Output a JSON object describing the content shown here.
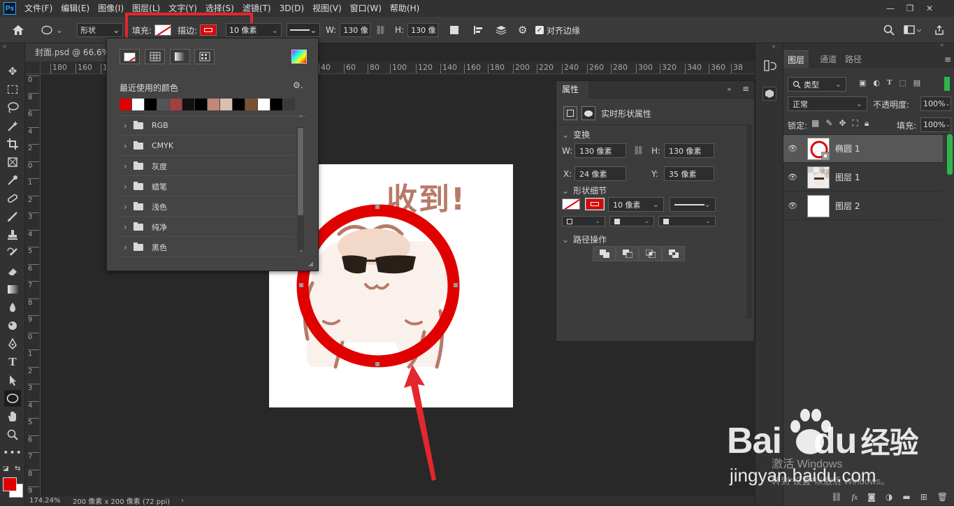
{
  "menubar": {
    "logo": "Ps",
    "items": [
      "文件(F)",
      "编辑(E)",
      "图像(I)",
      "图层(L)",
      "文字(Y)",
      "选择(S)",
      "滤镜(T)",
      "3D(D)",
      "视图(V)",
      "窗口(W)",
      "帮助(H)"
    ],
    "window_controls": [
      "—",
      "❐",
      "✕"
    ]
  },
  "options": {
    "mode": "形状",
    "fill_label": "填充:",
    "stroke_label": "描边:",
    "stroke_width": "10 像素",
    "w_label": "W:",
    "w_value": "130 像",
    "h_label": "H:",
    "h_value": "130 像",
    "align_edges_label": "对齐边缘",
    "highlight_color": "#e5262d"
  },
  "document": {
    "tab_title": "封面.psd @ 66.6% (",
    "zoom": "174.24%",
    "doc_size": "200 像素 x 200 像素 (72 ppi)"
  },
  "ruler": {
    "h_ticks": [
      "180",
      "160",
      "140",
      "40",
      "60",
      "80",
      "100",
      "120",
      "140",
      "160",
      "180",
      "200",
      "220",
      "240",
      "260",
      "280",
      "300",
      "320",
      "340",
      "360",
      "38"
    ],
    "v_ticks": [
      "0",
      "8",
      "6",
      "4",
      "2",
      "0",
      "1",
      "2",
      "3",
      "4",
      "5",
      "6",
      "7",
      "8",
      "9",
      "0",
      "1",
      "2",
      "3",
      "4",
      "5",
      "6",
      "7",
      "8",
      "9"
    ]
  },
  "toolbar": {
    "tools": [
      "move",
      "marquee",
      "lasso",
      "magic-wand",
      "crop",
      "frame",
      "eyedropper",
      "healing",
      "brush",
      "stamp",
      "history-brush",
      "eraser",
      "gradient",
      "blur",
      "dodge",
      "pen",
      "type",
      "path-select",
      "ellipse",
      "hand",
      "zoom",
      "more"
    ],
    "foreground_color": "#e00000",
    "background_color": "#ffffff"
  },
  "color_popup": {
    "recent_label": "最近使用的颜色",
    "recent_colors": [
      "#e00000",
      "#ffffff",
      "#000000",
      "#555555",
      "#a04040",
      "#111111",
      "#000000",
      "#c08878",
      "#d8c0b4",
      "#000000",
      "#7a5230",
      "#ffffff",
      "#000000",
      "#3a3a3a"
    ],
    "folders": [
      "RGB",
      "CMYK",
      "灰度",
      "蜡笔",
      "浅色",
      "纯净",
      "黑色"
    ]
  },
  "properties": {
    "tab": "属性",
    "section_type": "实时形状属性",
    "transform_label": "变换",
    "w_label": "W:",
    "w_value": "130 像素",
    "h_label": "H:",
    "h_value": "130 像素",
    "x_label": "X:",
    "x_value": "24 像素",
    "y_label": "Y:",
    "y_value": "35 像素",
    "shape_details_label": "形状细节",
    "stroke_width": "10 像素",
    "path_ops_label": "路径操作"
  },
  "artwork": {
    "caption": "收到!",
    "ring_color": "#e00000",
    "char_color": "#b77a68"
  },
  "layers": {
    "tabs": [
      "图层",
      "通道",
      "路径"
    ],
    "filter_label": "类型",
    "blend_mode": "正常",
    "opacity_label": "不透明度:",
    "opacity_value": "100%",
    "lock_label": "锁定:",
    "fill_label": "填充:",
    "fill_value": "100%",
    "items": [
      {
        "name": "椭圆 1",
        "selected": true
      },
      {
        "name": "图层 1",
        "selected": false
      },
      {
        "name": "图层 2",
        "selected": false
      }
    ],
    "bottom_icons": [
      "link-icon",
      "fx-icon",
      "mask-icon",
      "adjustment-icon",
      "folder-icon",
      "new-layer-icon",
      "trash-icon"
    ]
  },
  "watermark": {
    "brand": "Bai",
    "brand2": "du",
    "brand_cn": "经验",
    "url": "jingyan.baidu.com",
    "activate_line1": "激活 Windows",
    "activate_line2": "转到“设置”以激活 Windows。"
  }
}
